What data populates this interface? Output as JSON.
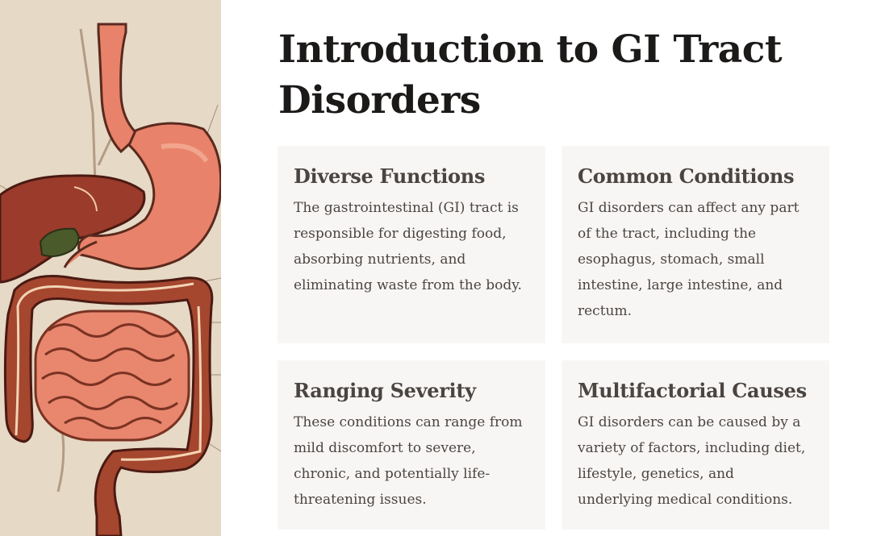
{
  "title": "Introduction to GI Tract Disorders",
  "cards": [
    {
      "heading": "Diverse Functions",
      "body": "The gastrointestinal (GI) tract is responsible for digesting food, absorbing nutrients, and eliminating waste from the body."
    },
    {
      "heading": "Common Conditions",
      "body": "GI disorders can affect any part of the tract, including the esophagus, stomach, small intestine, large intestine, and rectum."
    },
    {
      "heading": "Ranging Severity",
      "body": "These conditions can range from mild discomfort to severe, chronic, and potentially life-threatening issues."
    },
    {
      "heading": "Multifactorial Causes",
      "body": "GI disorders can be caused by a variety of factors, including diet, lifestyle, genetics, and underlying medical conditions."
    }
  ],
  "colors": {
    "illustration_background": "#e6d9c6",
    "card_background": "#f8f6f5",
    "title_text": "#1c1a19",
    "card_text": "#4b4541",
    "stomach": "#e8826a",
    "liver": "#9a3b2c",
    "intestine": "#e8866e",
    "colon": "#a5462f",
    "gallbladder": "#4a5a2a"
  }
}
